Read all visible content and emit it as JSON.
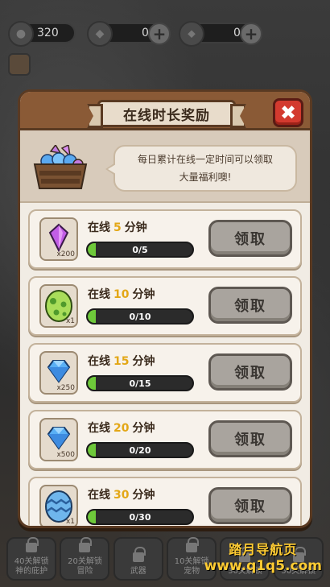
{
  "topbar": {
    "coins": "320",
    "diamonds": "0",
    "crystals": "0"
  },
  "bottom_bar": [
    {
      "label": "40关解锁\n神的庇护"
    },
    {
      "label": "20关解锁\n冒险"
    },
    {
      "label": "武器"
    },
    {
      "label": "10关解锁\n宠物"
    },
    {
      "label": "30关解锁"
    },
    {
      "label": "50关解锁"
    }
  ],
  "watermark": {
    "line1": "踏月导航页",
    "line2": "www.q1q5.com"
  },
  "panel": {
    "title": "在线时长奖励",
    "close_symbol": "✖",
    "bubble_line1": "每日累计在线一定时间可以领取",
    "bubble_line2": "大量福利噢!"
  },
  "rewards": [
    {
      "prefix": "在线",
      "minutes": "5",
      "suffix": "分钟",
      "item": "purple-crystal",
      "qty": "x200",
      "progress_text": "0/5",
      "progress": 0.0,
      "button": "领取"
    },
    {
      "prefix": "在线",
      "minutes": "10",
      "suffix": "分钟",
      "item": "green-egg",
      "qty": "x1",
      "progress_text": "0/10",
      "progress": 0.0,
      "button": "领取"
    },
    {
      "prefix": "在线",
      "minutes": "15",
      "suffix": "分钟",
      "item": "diamond",
      "qty": "x250",
      "progress_text": "0/15",
      "progress": 0.0,
      "button": "领取"
    },
    {
      "prefix": "在线",
      "minutes": "20",
      "suffix": "分钟",
      "item": "diamond",
      "qty": "x500",
      "progress_text": "0/20",
      "progress": 0.0,
      "button": "领取"
    },
    {
      "prefix": "在线",
      "minutes": "30",
      "suffix": "分钟",
      "item": "blue-egg",
      "qty": "x1",
      "progress_text": "0/30",
      "progress": 0.0,
      "button": "领取"
    }
  ],
  "colors": {
    "panel_bg": "#f1ece4",
    "header_brown": "#8a5a36",
    "close_red": "#d33a2f",
    "progress_green": "#6ec93a",
    "minutes_gold": "#e3a716",
    "claim_disabled": "#a9a49e"
  }
}
